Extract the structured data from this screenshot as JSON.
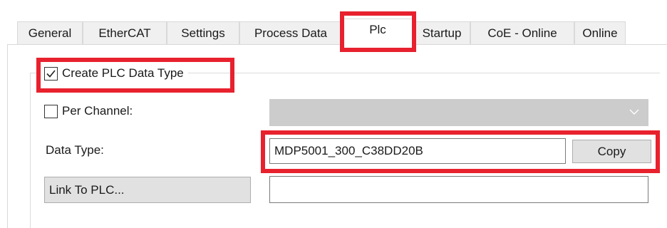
{
  "tabs": [
    {
      "label": "General"
    },
    {
      "label": "EtherCAT"
    },
    {
      "label": "Settings"
    },
    {
      "label": "Process Data"
    },
    {
      "label": "Plc"
    },
    {
      "label": "Startup"
    },
    {
      "label": "CoE - Online"
    },
    {
      "label": "Online"
    }
  ],
  "active_tab": "Plc",
  "plc": {
    "create_plc_data_type": {
      "label": "Create PLC Data Type",
      "checked": true
    },
    "per_channel": {
      "label": "Per Channel:",
      "checked": false,
      "value": ""
    },
    "data_type": {
      "label": "Data Type:",
      "value": "MDP5001_300_C38DD20B"
    },
    "copy_button": "Copy",
    "link_to_plc_button": "Link To PLC...",
    "link_value": ""
  },
  "highlight_color": "#e8212e",
  "icons": [
    "checkmark-icon",
    "chevron-down-icon"
  ]
}
